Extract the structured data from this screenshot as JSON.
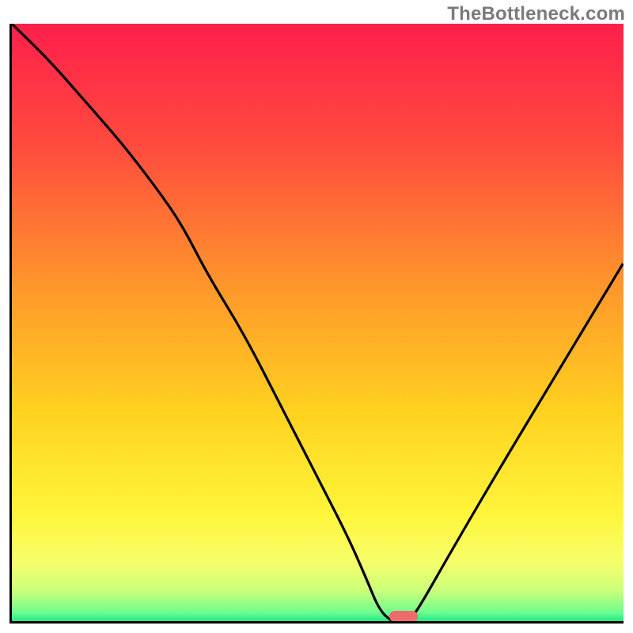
{
  "watermark": "TheBottleneck.com",
  "colors": {
    "gradient_stops": [
      {
        "pos": 0.0,
        "color": "#ff1f4b"
      },
      {
        "pos": 0.2,
        "color": "#ff4a3e"
      },
      {
        "pos": 0.45,
        "color": "#ff9a2a"
      },
      {
        "pos": 0.65,
        "color": "#ffd21f"
      },
      {
        "pos": 0.82,
        "color": "#fff53a"
      },
      {
        "pos": 0.9,
        "color": "#f6ff6a"
      },
      {
        "pos": 0.95,
        "color": "#c9ff7a"
      },
      {
        "pos": 0.985,
        "color": "#6fff8f"
      },
      {
        "pos": 1.0,
        "color": "#20e884"
      }
    ],
    "curve": "#000000",
    "marker": "#ef6a68"
  },
  "marker": {
    "x_pct": 64,
    "y_pct": 99.2
  },
  "chart_data": {
    "type": "line",
    "title": "",
    "xlabel": "",
    "ylabel": "",
    "xlim": [
      0,
      100
    ],
    "ylim": [
      0,
      100
    ],
    "note": "Background is a vertical red→yellow→green gradient. Black curve dips to ~0 at x≈63 (marked by small rounded bar), rises toward both edges. Values are visual estimates from the rendered pixels; the chart has no axis ticks or labels.",
    "series": [
      {
        "name": "bottleneck-curve",
        "x": [
          0,
          6,
          12,
          18,
          24,
          28,
          32,
          38,
          44,
          50,
          55,
          58,
          60,
          62,
          63,
          65,
          67,
          72,
          80,
          90,
          100
        ],
        "y": [
          100,
          94,
          87,
          80,
          72,
          66,
          58,
          48,
          36,
          24,
          14,
          7,
          2,
          0,
          0,
          0,
          3,
          12,
          26,
          43,
          60
        ]
      }
    ]
  }
}
